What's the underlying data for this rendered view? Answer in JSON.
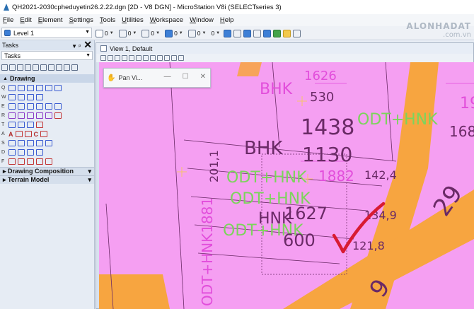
{
  "window": {
    "title": "QH2021-2030cpheduyetin26.2.22.dgn [2D - V8 DGN] - MicroStation V8i (SELECTseries 3)"
  },
  "menu": [
    "File",
    "Edit",
    "Element",
    "Settings",
    "Tools",
    "Utilities",
    "Workspace",
    "Window",
    "Help"
  ],
  "toolbar": {
    "level": "Level 1",
    "color_value": "0",
    "style_value": "0",
    "weight_value": "0",
    "fill_value": "0",
    "transparency_value": "0",
    "priority_value": "0"
  },
  "watermark": {
    "line1": "ALONHADAT",
    "line2": ".com.vn"
  },
  "tasks": {
    "header": "Tasks",
    "combo": "Tasks",
    "section_drawing": "Drawing",
    "section_drawing_composition": "Drawing Composition",
    "section_terrain": "Terrain Model"
  },
  "view": {
    "title": "View 1, Default",
    "pan_dialog": "Pan Vi..."
  },
  "map_labels": {
    "bhk1": "BHK",
    "n1626": "1626",
    "n530": "530",
    "n1438": "1438",
    "odt_hnk1": "ODT+HNK",
    "n168": "168",
    "n19": "19",
    "bhk2": "BHK",
    "n1130": "1130",
    "n201": "201,1",
    "odt_hnk2": "ODT+HNK",
    "n1882": "1882",
    "n142": "142,4",
    "odt_hnk3": "ODT+HNK",
    "n134": "134,9",
    "hnk": "HNK",
    "n1627": "1627",
    "odt_hnk4": "ODT+HNK",
    "n600": "600",
    "n121": "121,8",
    "odt_vert": "ODT+HNK1881",
    "n29": "29",
    "n9": "9"
  },
  "colors": {
    "parcel_fill": "#f59ff2",
    "road_fill": "#f7a540",
    "label_magenta": "#e24edb",
    "label_green": "#7cd45c",
    "checkmark": "#d81b32"
  }
}
